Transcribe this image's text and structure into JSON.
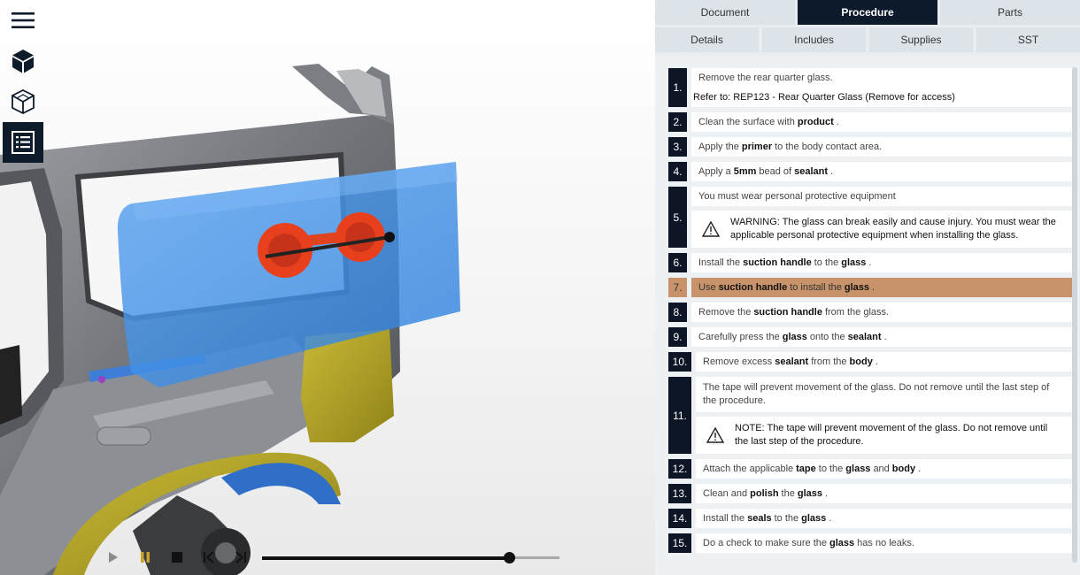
{
  "toolbar": {
    "icons": [
      "menu-icon",
      "cube-icon",
      "exploded-cube-icon",
      "procedure-list-icon"
    ],
    "active_index": 3
  },
  "player": {
    "progress": 0.83,
    "controls": [
      "play-icon",
      "pause-icon",
      "stop-icon",
      "prev-icon",
      "next-icon"
    ]
  },
  "tabs": {
    "main": [
      "Document",
      "Procedure",
      "Parts"
    ],
    "main_active": "Procedure",
    "sub": [
      "Details",
      "Includes",
      "Supplies",
      "SST"
    ]
  },
  "steps": [
    {
      "num": "1.",
      "lines": [
        "Remove the rear quarter glass."
      ],
      "ref": "Refer to: REP123 - Rear Quarter Glass (Remove for access)"
    },
    {
      "num": "2.",
      "html": "Clean the surface with <b>product</b>."
    },
    {
      "num": "3.",
      "html": "Apply the <b>primer</b> to the body contact area."
    },
    {
      "num": "4.",
      "html": "Apply a <b>5mm</b> bead of <b>sealant</b>."
    },
    {
      "num": "5.",
      "lines": [
        "You must wear personal protective equipment"
      ],
      "warning": "WARNING: The glass can break easily and cause injury. You must wear the applicable personal protective equipment when installing the glass."
    },
    {
      "num": "6.",
      "html": "Install the <b>suction handle</b> to the <b>glass</b>."
    },
    {
      "num": "7.",
      "html": "Use <b>suction handle</b> to install the <b>glass</b>.",
      "highlight": true
    },
    {
      "num": "8.",
      "html": "Remove the <b>suction handle</b> from the glass."
    },
    {
      "num": "9.",
      "html": "Carefully press the <b>glass</b> onto the <b>sealant</b>."
    },
    {
      "num": "10.",
      "html": "Remove excess <b>sealant</b> from the <b>body</b>."
    },
    {
      "num": "11.",
      "tall": "The tape will prevent movement of the glass. Do not remove until the last step of the procedure.",
      "warning": "NOTE: The tape will prevent movement of the glass. Do not remove until the last step of the procedure."
    },
    {
      "num": "12.",
      "html": "Attach the applicable <b>tape</b> to the <b>glass</b> and <b>body</b>."
    },
    {
      "num": "13.",
      "html": "Clean and <b>polish</b> the <b>glass</b>."
    },
    {
      "num": "14.",
      "html": "Install the <b>seals</b> to the <b>glass</b>."
    },
    {
      "num": "15.",
      "html": "Do a check to make sure the <b>glass</b> has no leaks."
    }
  ],
  "colors": {
    "active_tab": "#0c1a2c",
    "step_number": "#0d1626",
    "highlight": "#c8936a",
    "glass": "#3d8fe6",
    "suction_cup": "#e8401c",
    "body_panel": "#b5a626"
  }
}
